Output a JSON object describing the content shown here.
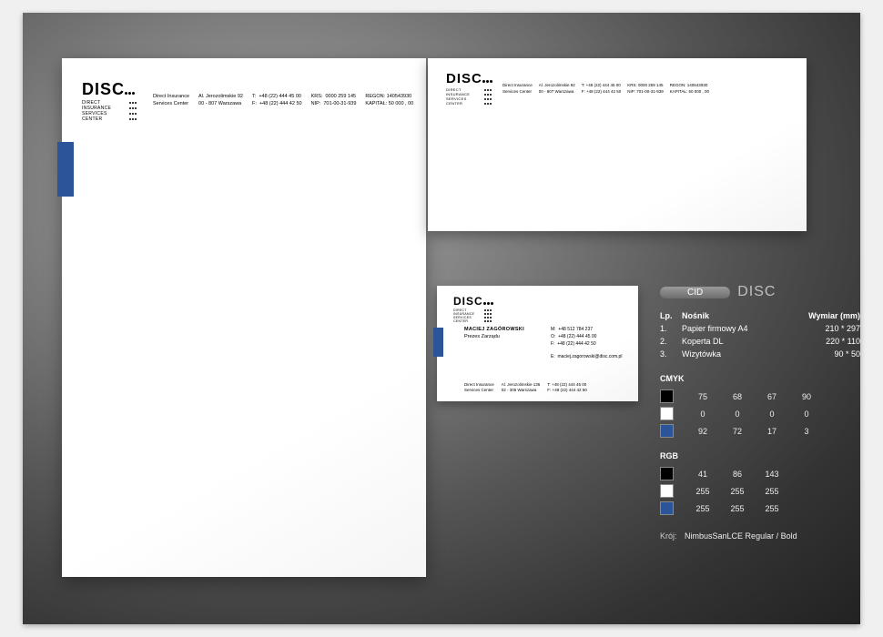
{
  "brand": {
    "name": "DISC",
    "sub1": "DIRECT",
    "sub2": "INSURANCE",
    "sub3": "SERVICES",
    "sub4": "CENTER"
  },
  "company": {
    "name1": "Direct Insurance",
    "name2": "Services Center",
    "addr1": "Al. Jerozolimskie 92",
    "addr2": "00 - 807  Warszawa",
    "tel_label": "T:",
    "tel": "+48 (22) 444 45 00",
    "fax_label": "F:",
    "fax": "+48 (22) 444 42 50",
    "krs_label": "KRS:",
    "krs": "0000 259 145",
    "nip_label": "NIP:",
    "nip": "701-00-31-939",
    "regon_label": "REGON:",
    "regon": "140543930",
    "kapital_label": "KAPITAŁ:",
    "kapital": "50 000 , 00"
  },
  "card": {
    "name": "MACIEJ  ZAGÓROWSKI",
    "title": "Prezes Zarządu",
    "m_label": "M:",
    "m": "+48 512 784 237",
    "o_label": "O:",
    "o": "+48 (22) 444 45 00",
    "f_label": "F:",
    "f": "+48 (22) 444 42 50",
    "e_label": "E:",
    "e": "maciej.zagorowski@disc.com.pl",
    "footer_addr1": "Al. Jerozolimskie 136",
    "footer_addr2": "02 - 305  Warszawa"
  },
  "cid": {
    "label": "CID",
    "brand": "DISC",
    "headers": {
      "lp": "Lp.",
      "item": "Nośnik",
      "dim": "Wymiar (mm)"
    },
    "items": [
      {
        "lp": "1.",
        "name": "Papier firmowy A4",
        "dim": "210   *   297"
      },
      {
        "lp": "2.",
        "name": "Koperta DL",
        "dim": "220   *   110"
      },
      {
        "lp": "3.",
        "name": "Wizytówka",
        "dim": "90   *    50"
      }
    ],
    "cmyk_label": "CMYK",
    "cmyk": [
      {
        "cls": "sw-black",
        "v": [
          "75",
          "68",
          "67",
          "90"
        ]
      },
      {
        "cls": "sw-white",
        "v": [
          "0",
          "0",
          "0",
          "0"
        ]
      },
      {
        "cls": "sw-blue",
        "v": [
          "92",
          "72",
          "17",
          "3"
        ]
      }
    ],
    "rgb_label": "RGB",
    "rgb": [
      {
        "cls": "sw-black",
        "v": [
          "41",
          "86",
          "143"
        ]
      },
      {
        "cls": "sw-white",
        "v": [
          "255",
          "255",
          "255"
        ]
      },
      {
        "cls": "sw-blue",
        "v": [
          "255",
          "255",
          "255"
        ]
      }
    ],
    "font_label": "Krój:",
    "font_value": "NimbusSanLCE Regular / Bold"
  }
}
